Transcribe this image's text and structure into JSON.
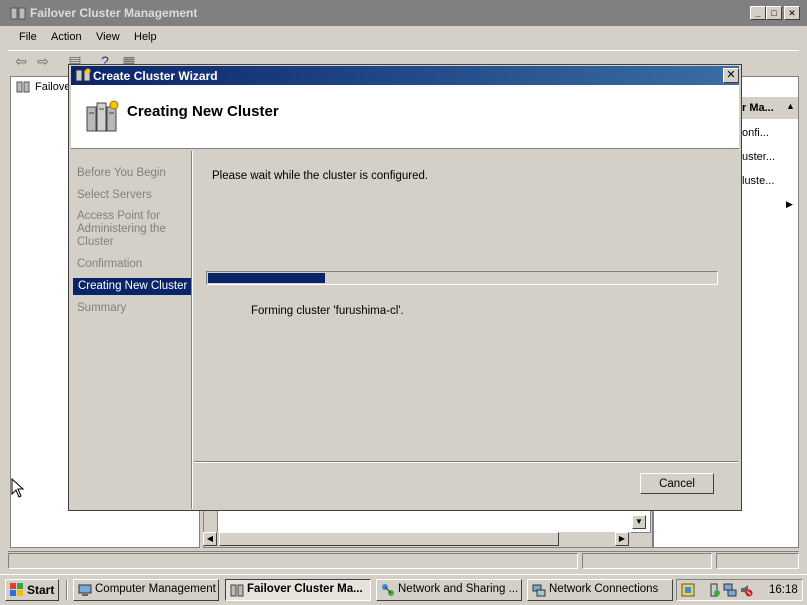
{
  "mmc": {
    "title": "Failover Cluster Management",
    "icon": "cluster-icon",
    "controls": {
      "minimize": "_",
      "maximize": "□",
      "close": "✕"
    },
    "menu": [
      "File",
      "Action",
      "View",
      "Help"
    ],
    "toolbar_icons": [
      "back-arrow-icon",
      "forward-arrow-icon",
      "console-tree-icon",
      "help-icon",
      "properties-icon"
    ],
    "tree": {
      "root_label": "Failove"
    },
    "actions": {
      "header": "r Ma...",
      "items": [
        "onfi...",
        "uster...",
        "luste..."
      ]
    }
  },
  "wizard": {
    "title": "Create Cluster Wizard",
    "icon": "cluster-wizard-icon",
    "header_title": "Creating New Cluster",
    "header_icon": "cluster-servers-icon",
    "close_label": "✕",
    "steps": [
      {
        "label": "Before You Begin",
        "active": false
      },
      {
        "label": "Select Servers",
        "active": false
      },
      {
        "label": "Access Point for Administering the Cluster",
        "active": false
      },
      {
        "label": "Confirmation",
        "active": false
      },
      {
        "label": "Creating New Cluster",
        "active": true
      },
      {
        "label": "Summary",
        "active": false
      }
    ],
    "status_text": "Please wait while the cluster is configured.",
    "progress_fraction": 0.23,
    "detail_text": "Forming cluster 'furushima-cl'.",
    "cancel_label": "Cancel"
  },
  "taskbar": {
    "start_label": "Start",
    "tasks": [
      {
        "label": "Computer Management",
        "icon": "computer-management-icon",
        "active": false
      },
      {
        "label": "Failover Cluster Ma...",
        "icon": "failover-cluster-icon",
        "active": true
      },
      {
        "label": "Network and Sharing ...",
        "icon": "network-sharing-icon",
        "active": false
      },
      {
        "label": "Network Connections",
        "icon": "network-connections-icon",
        "active": false
      }
    ],
    "tray_icons": [
      "tray-app-icon",
      "tray-safely-remove-icon",
      "tray-network-icon",
      "tray-volume-muted-icon"
    ],
    "clock": "16:18"
  },
  "colors": {
    "accent": "#0a246a",
    "accent_light": "#3a6ea5",
    "face": "#d4d0c8",
    "inactive_title": "#808080"
  }
}
